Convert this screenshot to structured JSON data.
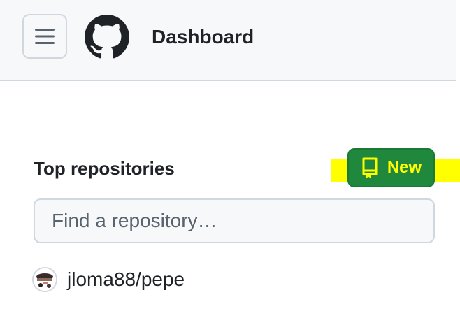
{
  "header": {
    "title": "Dashboard",
    "menu_icon": "hamburger-menu-icon",
    "logo_icon": "github-logo-icon"
  },
  "repositories": {
    "heading": "Top repositories",
    "new_button": {
      "label": "New",
      "icon": "repo-icon",
      "background": "#1f883d",
      "highlight": "#ffff00"
    },
    "search": {
      "placeholder": "Find a repository…",
      "value": ""
    },
    "items": [
      {
        "name": "jloma88/pepe",
        "avatar_icon": "user-avatar"
      }
    ]
  }
}
